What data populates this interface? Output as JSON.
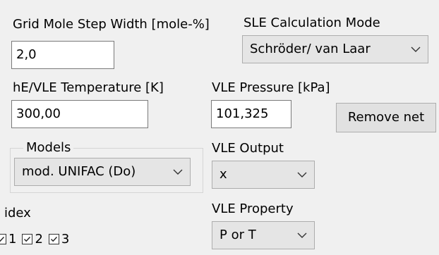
{
  "grid_step": {
    "label": "Grid Mole Step Width [mole-%]",
    "value": "2,0"
  },
  "sle_mode": {
    "label": "SLE Calculation Mode",
    "selected": "Schröder/ van Laar"
  },
  "he_vle_temp": {
    "label": "hE/VLE Temperature [K]",
    "value": "300,00"
  },
  "vle_pressure": {
    "label": "VLE Pressure [kPa]",
    "value": "101,325"
  },
  "remove_net_button": {
    "label": "Remove net"
  },
  "models": {
    "label": "Models",
    "selected": "mod. UNIFAC (Do)"
  },
  "vle_output": {
    "label": "VLE Output",
    "selected": "x"
  },
  "vle_property": {
    "label": "VLE Property",
    "selected": "P or T"
  },
  "index": {
    "label": "idex",
    "checkboxes": [
      {
        "label": "1",
        "checked": true
      },
      {
        "label": "2",
        "checked": true
      },
      {
        "label": "3",
        "checked": true
      }
    ]
  },
  "icons": {
    "dropdown": "chevron-down-icon",
    "checkmark": "checkmark-icon"
  },
  "colors": {
    "window_bg": "#f0f0f0",
    "combo_bg": "#e5e5e5",
    "button_bg": "#e1e1e1",
    "border": "#7a7a7a"
  }
}
